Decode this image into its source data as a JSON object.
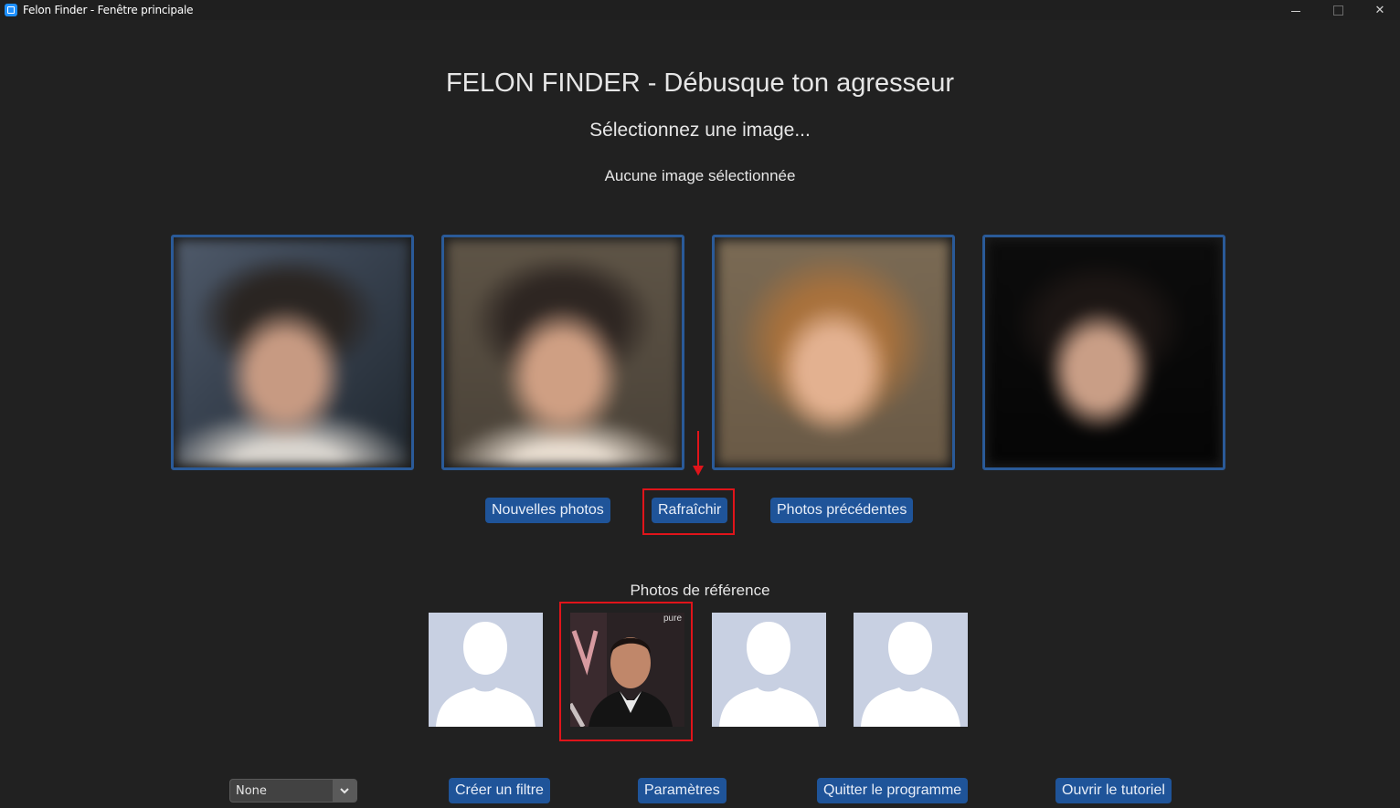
{
  "window": {
    "title": "Felon Finder - Fenêtre principale",
    "minimize_glyph": "",
    "close_glyph": "✕"
  },
  "header": {
    "title": "FELON FINDER - Débusque ton agresseur",
    "subtitle": "Sélectionnez une image...",
    "status": "Aucune image sélectionnée"
  },
  "generated_faces": [
    {
      "name": "generated-face-1"
    },
    {
      "name": "generated-face-2"
    },
    {
      "name": "generated-face-3"
    },
    {
      "name": "generated-face-4"
    }
  ],
  "actions": {
    "new_photos": "Nouvelles photos",
    "refresh": "Rafraîchir",
    "previous_photos": "Photos précédentes"
  },
  "reference": {
    "label": "Photos de référence",
    "photo_caption": "pure"
  },
  "footer": {
    "filter_select_value": "None",
    "create_filter": "Créer un filtre",
    "settings": "Paramètres",
    "quit": "Quitter le programme",
    "tutorial": "Ouvrir le tutoriel"
  },
  "colors": {
    "background": "#212121",
    "accent": "#1f5499",
    "tile_border": "#2a5a98",
    "highlight": "#e0141a",
    "placeholder_bg": "#c8d0e2"
  }
}
